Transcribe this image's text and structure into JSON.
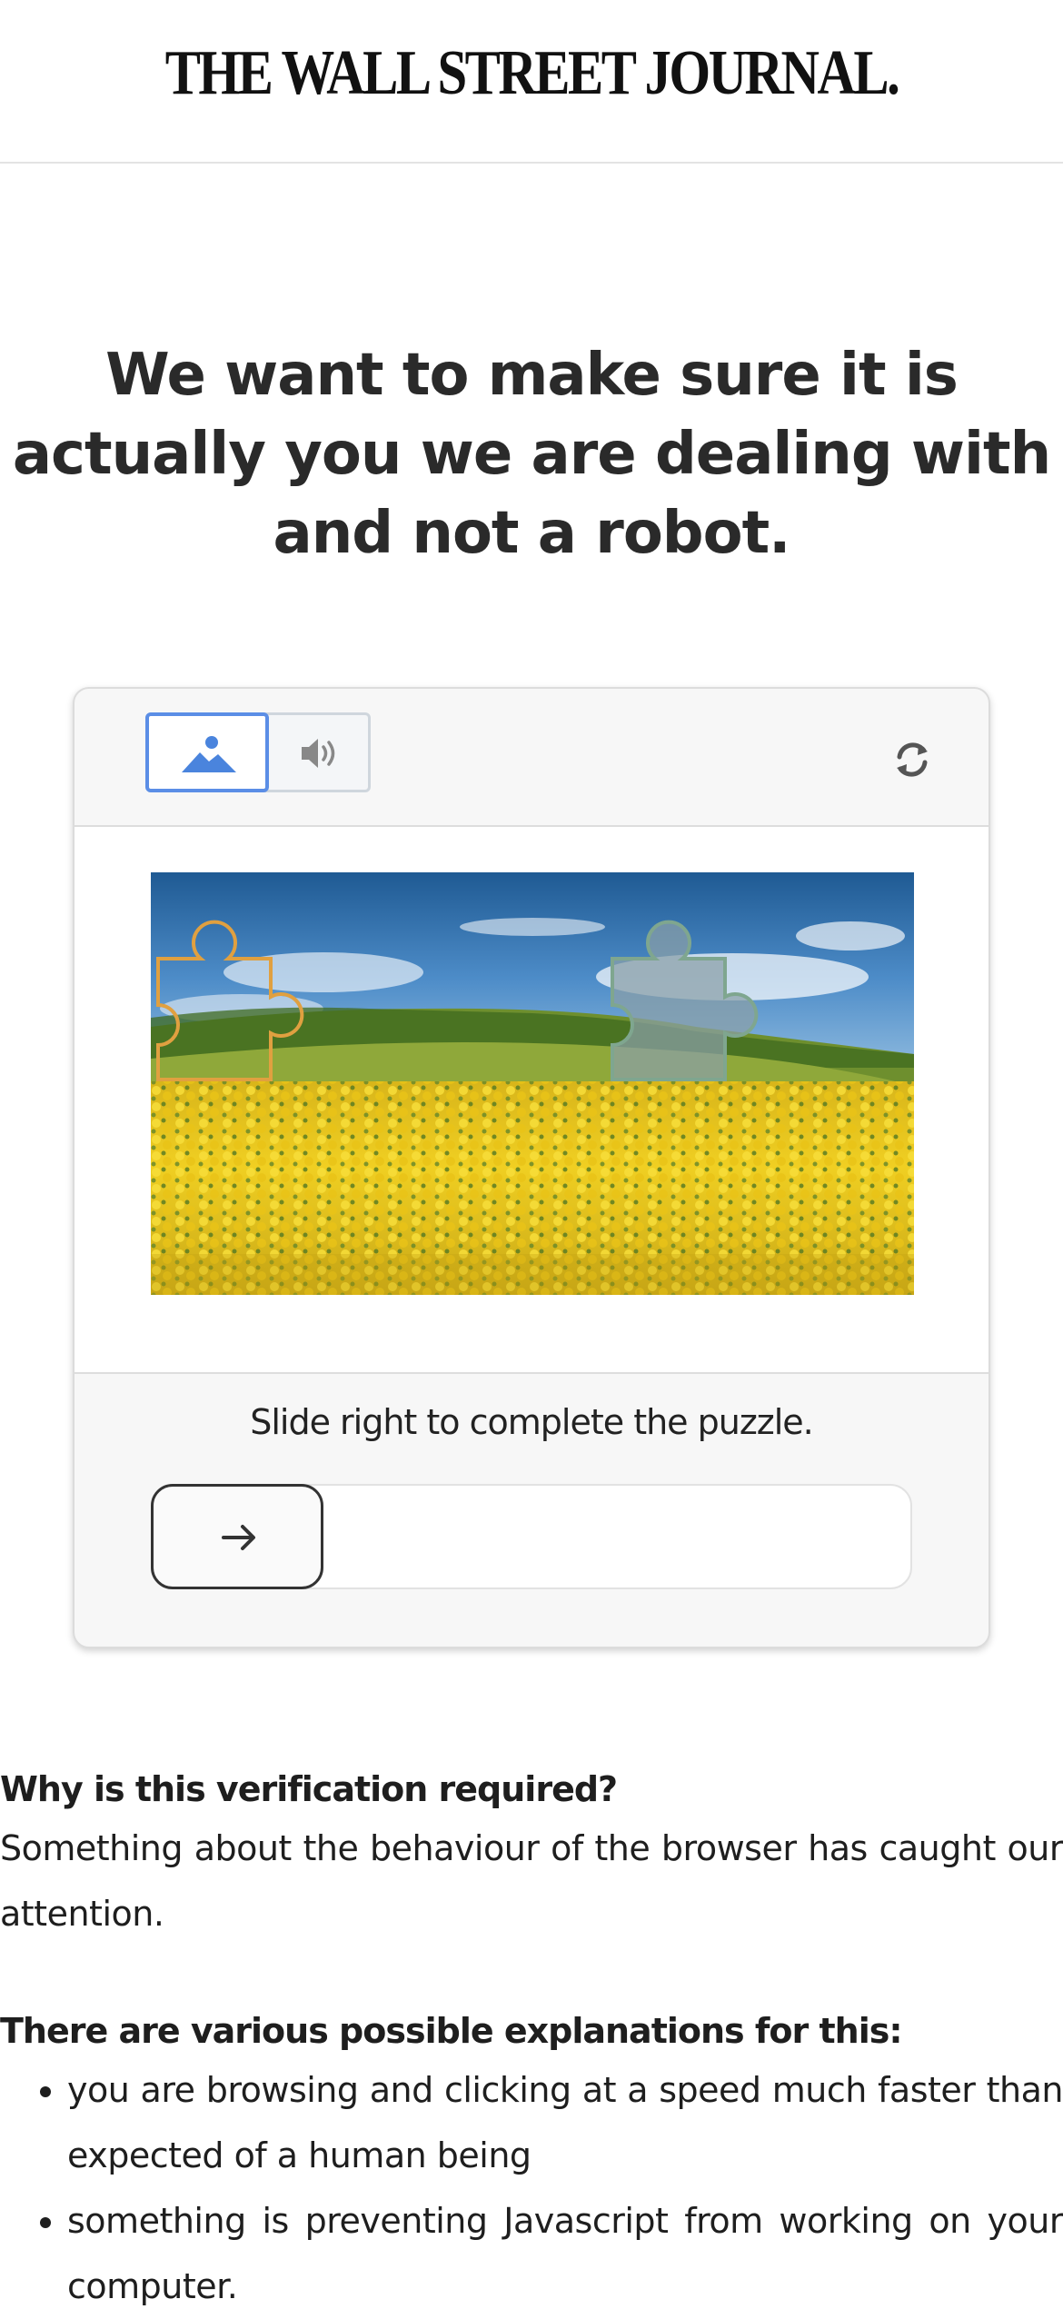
{
  "header": {
    "logo_text": "THE WALL STREET JOURNAL."
  },
  "headline": "We want to make sure it is actually you we are dealing with and not a robot.",
  "captcha": {
    "modes": {
      "image_icon": "image-icon",
      "audio_icon": "speaker-icon",
      "selected": "image"
    },
    "refresh_icon": "refresh-icon",
    "instruction": "Slide right to complete the puzzle.",
    "slider_handle_icon": "arrow-right-icon",
    "slider_progress": 0,
    "colors": {
      "accent": "#5b8ee6",
      "target_outline": "#e0a040"
    }
  },
  "info": {
    "why_heading": "Why is this verification required?",
    "why_text": "Something about the behaviour of the browser has caught our attention.",
    "explanations_heading": "There are various possible explanations for this:",
    "explanations": [
      "you are browsing and clicking at a speed much faster than expected of a human being",
      "something is preventing Javascript from working on your computer."
    ]
  }
}
